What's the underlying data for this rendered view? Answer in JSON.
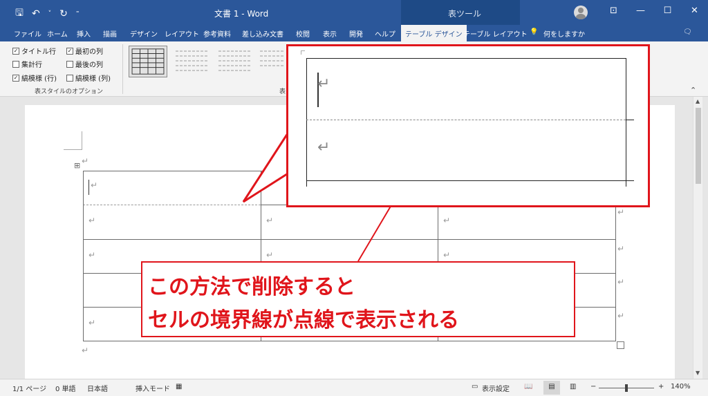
{
  "titlebar": {
    "title": "文書 1 - Word",
    "context_label": "表ツール",
    "qat": {
      "save": "🖫",
      "undo": "↶",
      "undo_menu": "˅",
      "redo": "↻",
      "customize": "⁼"
    },
    "window_buttons": [
      "⊡",
      "—",
      "☐",
      "✕"
    ]
  },
  "tabs": [
    {
      "label": "ファイル"
    },
    {
      "label": "ホーム"
    },
    {
      "label": "挿入"
    },
    {
      "label": "描画"
    },
    {
      "label": "デザイン"
    },
    {
      "label": "レイアウト"
    },
    {
      "label": "参考資料"
    },
    {
      "label": "差し込み文書"
    },
    {
      "label": "校閲"
    },
    {
      "label": "表示"
    },
    {
      "label": "開発"
    },
    {
      "label": "ヘルプ"
    },
    {
      "label": "テーブル デザイン"
    },
    {
      "label": "テーブル レイアウト"
    }
  ],
  "search": {
    "icon": "lightbulb-icon",
    "label": "何をしますか"
  },
  "share_icon": "comment-icon",
  "ribbon": {
    "options": [
      {
        "label": "タイトル行",
        "checked": true
      },
      {
        "label": "最初の列",
        "checked": true
      },
      {
        "label": "集計行",
        "checked": false
      },
      {
        "label": "最後の列",
        "checked": false
      },
      {
        "label": "縞模様 (行)",
        "checked": true
      },
      {
        "label": "縞模様 (列)",
        "checked": false
      }
    ],
    "options_group_label": "表スタイルのオプション",
    "styles_group_label_partial": "表"
  },
  "document": {
    "para_mark": "↵",
    "cell_mark": "↵",
    "move_handle": "⊞"
  },
  "callout": {
    "line1": "この方法で削除すると",
    "line2": "セルの境界線が点線で表示される"
  },
  "statusbar": {
    "page": "1/1 ページ",
    "words": "0 単語",
    "language": "日本語",
    "mode": "挿入モード",
    "display_settings": "表示設定",
    "zoom": "140%",
    "zoom_minus": "−",
    "zoom_plus": "+",
    "zoom_level": 0.5
  },
  "colors": {
    "accent": "#2b579a",
    "callout": "#e0151b"
  }
}
